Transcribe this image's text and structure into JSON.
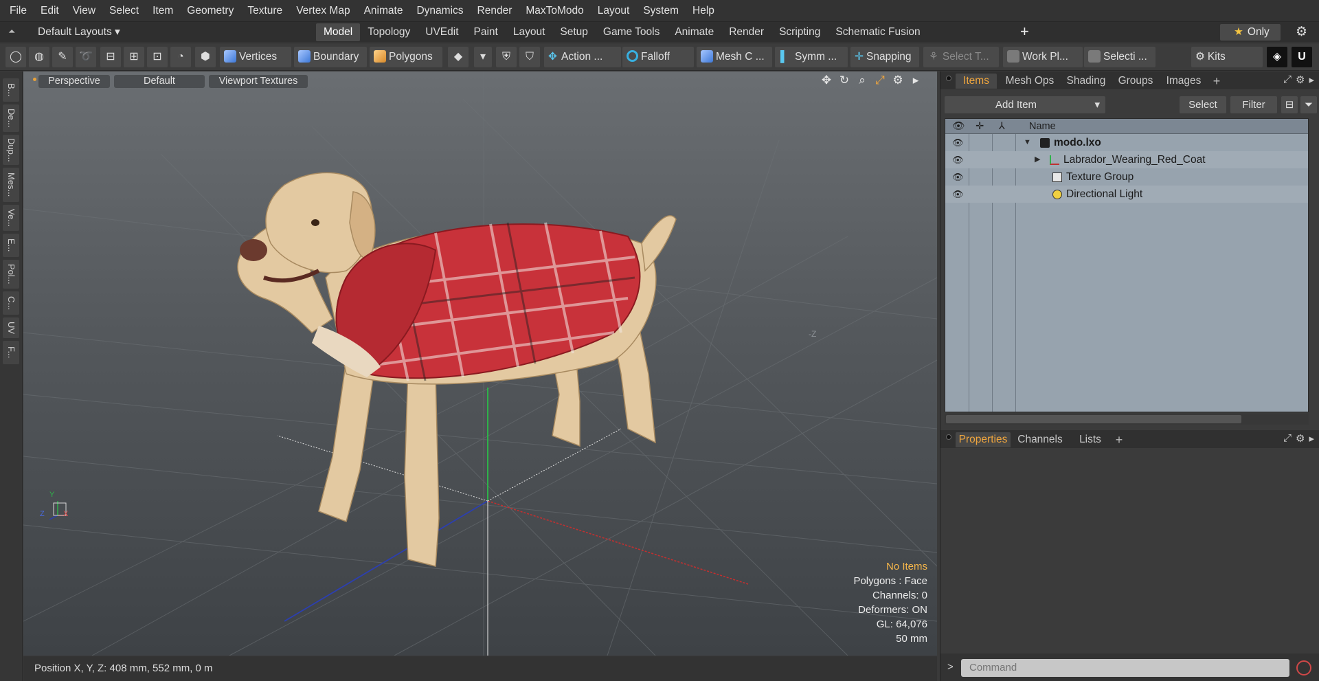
{
  "menu": [
    "File",
    "Edit",
    "View",
    "Select",
    "Item",
    "Geometry",
    "Texture",
    "Vertex Map",
    "Animate",
    "Dynamics",
    "Render",
    "MaxToModo",
    "Layout",
    "System",
    "Help"
  ],
  "layout_bar": {
    "default_layouts": "Default Layouts ▾",
    "tabs": [
      "Model",
      "Topology",
      "UVEdit",
      "Paint",
      "Layout",
      "Setup",
      "Game Tools",
      "Animate",
      "Render",
      "Scripting",
      "Schematic Fusion"
    ],
    "active_tab": "Model",
    "plus": "+",
    "only": "Only",
    "star": "★"
  },
  "toolbar": {
    "vertices": "Vertices",
    "boundary": "Boundary",
    "polygons": "Polygons",
    "action": "Action",
    "action_more": "...",
    "falloff": "Falloff",
    "mesh": "Mesh C ...",
    "symm": "Symm ...",
    "snapping": "Snapping",
    "select_t": "Select T...",
    "work_pl": "Work Pl...",
    "selecti": "Selecti ...",
    "kits": "Kits"
  },
  "left_strip": [
    "B...",
    "De...",
    "Dup...",
    "Mes...",
    "Ve...",
    "E...",
    "Pol...",
    "C...",
    "UV",
    "F..."
  ],
  "viewport": {
    "perspective": "Perspective",
    "default": "Default",
    "textures": "Viewport Textures",
    "neg_z": "-Z",
    "info": {
      "no_items": "No Items",
      "polygons": "Polygons : Face",
      "channels": "Channels: 0",
      "deformers": "Deformers: ON",
      "gl": "GL: 64,076",
      "size": "50 mm"
    },
    "axis": {
      "y": "Y",
      "z": "Z",
      "x": "X"
    }
  },
  "status": {
    "position": "Position X, Y, Z:   408 mm, 552 mm, 0 m"
  },
  "items_panel": {
    "tabs": [
      "Items",
      "Mesh Ops",
      "Shading",
      "Groups",
      "Images"
    ],
    "active": "Items",
    "plus": "+",
    "add_item": "Add Item",
    "select": "Select",
    "filter": "Filter",
    "header_name": "Name",
    "rows": [
      {
        "label": "modo.lxo"
      },
      {
        "label": "Labrador_Wearing_Red_Coat"
      },
      {
        "label": "Texture Group"
      },
      {
        "label": "Directional Light"
      }
    ]
  },
  "props_panel": {
    "tabs": [
      "Properties",
      "Channels",
      "Lists"
    ],
    "active": "Properties",
    "plus": "+"
  },
  "command": {
    "prompt": ">",
    "placeholder": "Command"
  },
  "colors": {
    "accent_orange": "#f0a63e",
    "coat_red": "#c8323a",
    "axis_x": "#c03030",
    "axis_y": "#2fb24a",
    "axis_z": "#2c3fb0"
  }
}
